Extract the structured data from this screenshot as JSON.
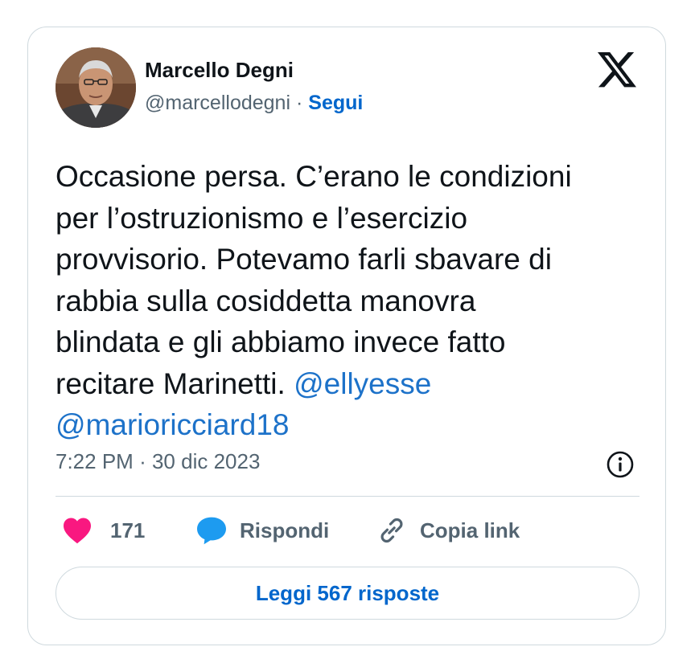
{
  "author": {
    "name": "Marcello Degni",
    "handle": "@marcellodegni",
    "separator": "·",
    "follow_label": "Segui"
  },
  "tweet": {
    "text": "Occasione persa. C’erano le condizioni\nper l’ostruzionismo e l’esercizio\nprovvisorio. Potevamo farli sbavare di\nrabbia sulla cosiddetta manovra\nblindata e gli abbiamo invece fatto\nrecitare Marinetti. ",
    "mentions": [
      "@ellyesse",
      "@marioricciard18"
    ],
    "time": "7:22 PM",
    "date": "30 dic 2023"
  },
  "actions": {
    "likes": "171",
    "reply_label": "Rispondi",
    "copy_label": "Copia link"
  },
  "read_replies_label": "Leggi 567 risposte",
  "icons": {
    "logo": "x-logo-icon",
    "info": "info-icon",
    "like": "heart-icon",
    "reply": "speech-bubble-icon",
    "copy": "link-icon"
  },
  "colors": {
    "heart": "#f91880",
    "reply": "#1d9bf0",
    "link": "#1d72c9",
    "follow": "#0066cc",
    "muted": "#536471",
    "border": "#cfd9de"
  }
}
